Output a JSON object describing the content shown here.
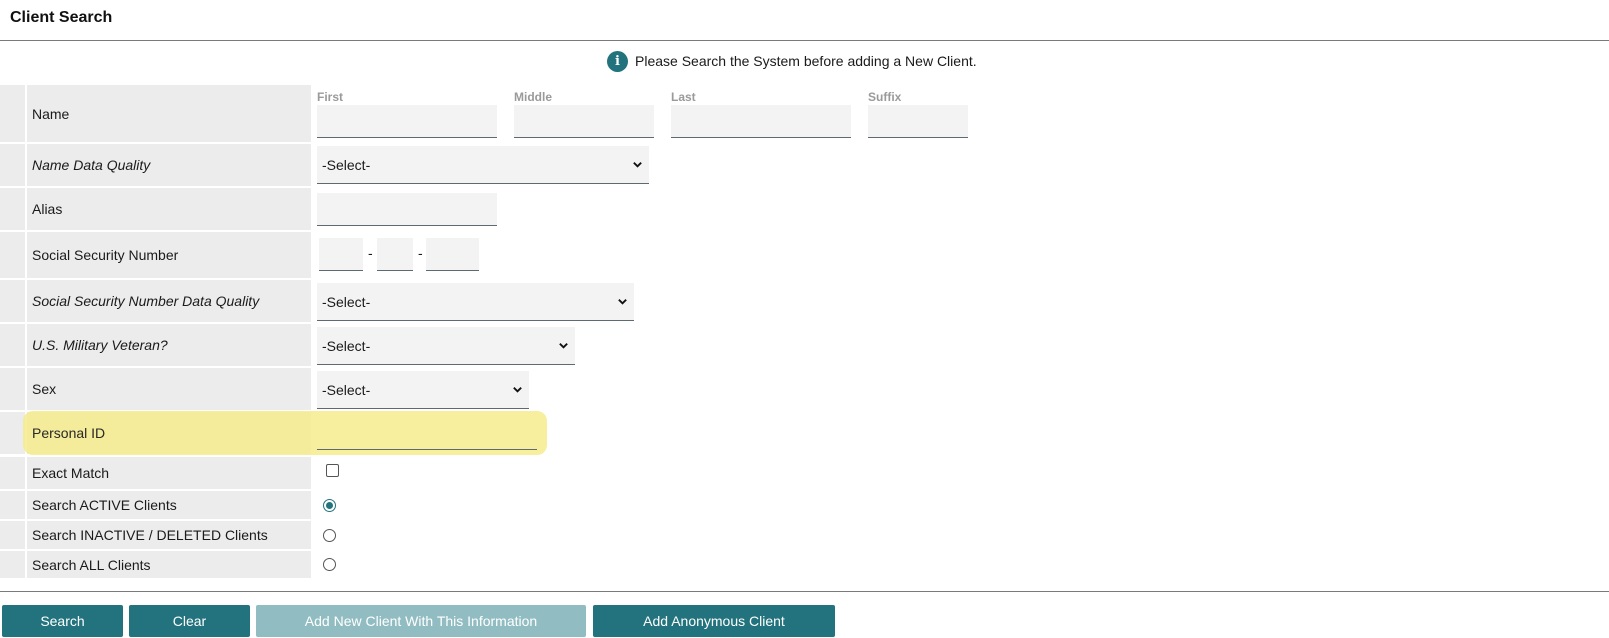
{
  "header": {
    "title": "Client Search"
  },
  "notice": {
    "icon": "info-icon",
    "text": "Please Search the System before adding a New Client."
  },
  "form": {
    "name": {
      "label": "Name",
      "first_caption": "First",
      "middle_caption": "Middle",
      "last_caption": "Last",
      "suffix_caption": "Suffix",
      "first_value": "",
      "middle_value": "",
      "last_value": "",
      "suffix_value": ""
    },
    "name_data_quality": {
      "label": "Name Data Quality",
      "value": "-Select-"
    },
    "alias": {
      "label": "Alias",
      "value": ""
    },
    "ssn": {
      "label": "Social Security Number",
      "separator": "-",
      "part1": "",
      "part2": "",
      "part3": ""
    },
    "ssn_data_quality": {
      "label": "Social Security Number Data Quality",
      "value": "-Select-"
    },
    "veteran": {
      "label": "U.S. Military Veteran?",
      "value": "-Select-"
    },
    "sex": {
      "label": "Sex",
      "value": "-Select-"
    },
    "personal_id": {
      "label": "Personal ID",
      "value": ""
    },
    "exact_match": {
      "label": "Exact Match",
      "checked": false
    },
    "search_scope": {
      "options": [
        {
          "label": "Search ACTIVE Clients",
          "checked": true
        },
        {
          "label": "Search INACTIVE / DELETED Clients",
          "checked": false
        },
        {
          "label": "Search ALL Clients",
          "checked": false
        }
      ]
    }
  },
  "buttons": {
    "search": "Search",
    "clear": "Clear",
    "add_new": "Add New Client With This Information",
    "add_anonymous": "Add Anonymous Client"
  },
  "colors": {
    "accent": "#22737d",
    "accent_disabled": "#91bdc2",
    "highlight": "#f6ec8c",
    "label_bg": "#ececec"
  }
}
